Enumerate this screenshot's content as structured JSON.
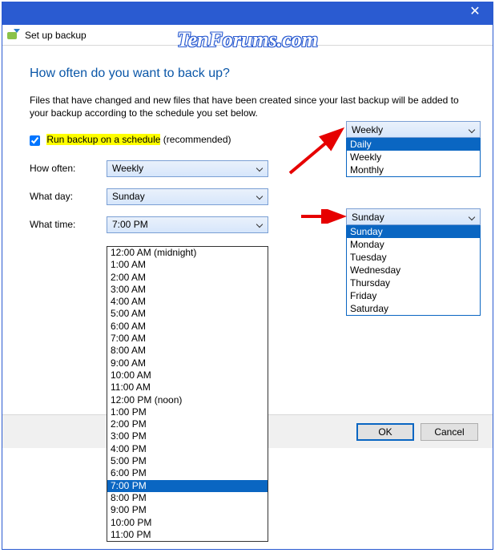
{
  "titlebar": {
    "page_title": "Set up backup"
  },
  "watermark": "TenForums.com",
  "heading": "How often do you want to back up?",
  "description": "Files that have changed and new files that have been created since your last backup will be added to your backup according to the schedule you set below.",
  "checkbox": {
    "label": "Run backup on a schedule",
    "suffix": " (recommended)",
    "checked": true
  },
  "fields": {
    "how_often": {
      "label": "How often:",
      "value": "Weekly"
    },
    "what_day": {
      "label": "What day:",
      "value": "Sunday"
    },
    "what_time": {
      "label": "What time:",
      "value": "7:00 PM"
    }
  },
  "freq_popup": {
    "selected": "Weekly",
    "highlight": "Daily",
    "options": [
      "Daily",
      "Weekly",
      "Monthly"
    ]
  },
  "day_popup": {
    "selected": "Sunday",
    "highlight": "Sunday",
    "options": [
      "Sunday",
      "Monday",
      "Tuesday",
      "Wednesday",
      "Thursday",
      "Friday",
      "Saturday"
    ]
  },
  "time_popup": {
    "highlight": "7:00 PM",
    "options": [
      "12:00 AM (midnight)",
      "1:00 AM",
      "2:00 AM",
      "3:00 AM",
      "4:00 AM",
      "5:00 AM",
      "6:00 AM",
      "7:00 AM",
      "8:00 AM",
      "9:00 AM",
      "10:00 AM",
      "11:00 AM",
      "12:00 PM (noon)",
      "1:00 PM",
      "2:00 PM",
      "3:00 PM",
      "4:00 PM",
      "5:00 PM",
      "6:00 PM",
      "7:00 PM",
      "8:00 PM",
      "9:00 PM",
      "10:00 PM",
      "11:00 PM"
    ]
  },
  "buttons": {
    "ok": "OK",
    "cancel": "Cancel"
  }
}
